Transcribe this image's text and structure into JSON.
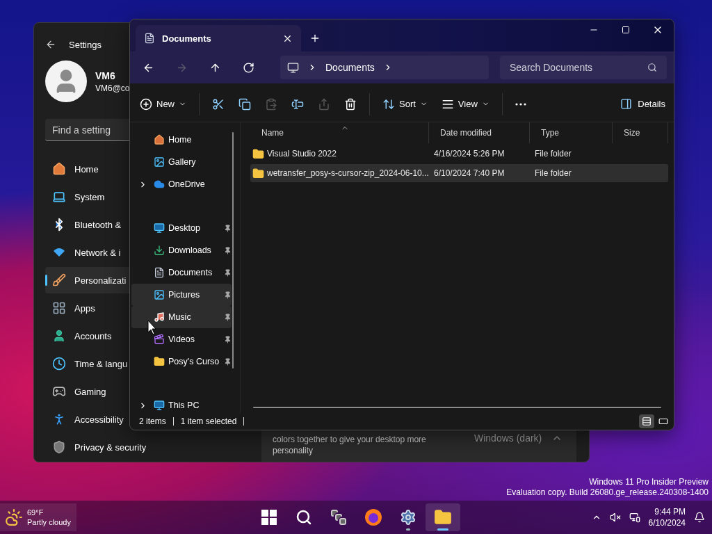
{
  "desktop": {
    "watermark": [
      "Windows 11 Pro Insider Preview",
      "Evaluation copy. Build 26080.ge_release.240308-1400"
    ]
  },
  "settings_window": {
    "title": "Settings",
    "user": {
      "name": "VM6",
      "email": "VM6@co"
    },
    "search": {
      "placeholder": "Find a setting"
    },
    "nav": [
      {
        "kind": "home",
        "label": "Home",
        "selected": false
      },
      {
        "kind": "system",
        "label": "System",
        "selected": false
      },
      {
        "kind": "bluetooth",
        "label": "Bluetooth &",
        "selected": false
      },
      {
        "kind": "network",
        "label": "Network & i",
        "selected": false
      },
      {
        "kind": "personalization",
        "label": "Personalizati",
        "selected": true
      },
      {
        "kind": "apps",
        "label": "Apps",
        "selected": false
      },
      {
        "kind": "accounts",
        "label": "Accounts",
        "selected": false
      },
      {
        "kind": "time",
        "label": "Time & langu",
        "selected": false
      },
      {
        "kind": "gaming",
        "label": "Gaming",
        "selected": false
      },
      {
        "kind": "accessibility",
        "label": "Accessibility",
        "selected": false
      },
      {
        "kind": "privacy",
        "label": "Privacy & security",
        "selected": false
      }
    ],
    "card": {
      "description": "colors together to give your desktop more personality",
      "value": "Windows (dark)",
      "expanded": true
    }
  },
  "explorer": {
    "tab": {
      "title": "Documents"
    },
    "nav_buttons": [
      {
        "kind": "back",
        "disabled": false
      },
      {
        "kind": "forward",
        "disabled": true
      },
      {
        "kind": "up",
        "disabled": false
      },
      {
        "kind": "refresh",
        "disabled": false
      }
    ],
    "breadcrumb": [
      "Documents"
    ],
    "search": {
      "placeholder": "Search Documents"
    },
    "toolbar": [
      [
        {
          "kind": "new",
          "label": "New",
          "dropdown": true,
          "disabled": false
        }
      ],
      [
        {
          "kind": "cut",
          "disabled": false
        },
        {
          "kind": "copy",
          "disabled": false
        },
        {
          "kind": "paste",
          "disabled": true
        },
        {
          "kind": "rename",
          "disabled": false
        },
        {
          "kind": "share",
          "disabled": true
        },
        {
          "kind": "delete",
          "disabled": false
        }
      ],
      [
        {
          "kind": "sort",
          "label": "Sort",
          "dropdown": true,
          "disabled": false
        },
        {
          "kind": "view",
          "label": "View",
          "dropdown": true,
          "disabled": false
        }
      ],
      [
        {
          "kind": "more",
          "disabled": false
        }
      ]
    ],
    "details_button": "Details",
    "sidebar": [
      [
        {
          "kind": "home",
          "label": "Home",
          "expandable": false,
          "pinned": false,
          "highlighted": false
        },
        {
          "kind": "gallery",
          "label": "Gallery",
          "expandable": false,
          "pinned": false,
          "highlighted": false
        },
        {
          "kind": "onedrive",
          "label": "OneDrive",
          "expandable": true,
          "pinned": false,
          "highlighted": false
        }
      ],
      [
        {
          "kind": "desktop",
          "label": "Desktop",
          "expandable": false,
          "pinned": true,
          "highlighted": false
        },
        {
          "kind": "downloads",
          "label": "Downloads",
          "expandable": false,
          "pinned": true,
          "highlighted": false
        },
        {
          "kind": "documents",
          "label": "Documents",
          "expandable": false,
          "pinned": true,
          "highlighted": false
        },
        {
          "kind": "pictures",
          "label": "Pictures",
          "expandable": false,
          "pinned": true,
          "highlighted": true
        },
        {
          "kind": "music",
          "label": "Music",
          "expandable": false,
          "pinned": true,
          "highlighted": true
        },
        {
          "kind": "videos",
          "label": "Videos",
          "expandable": false,
          "pinned": true,
          "highlighted": false
        },
        {
          "kind": "folder",
          "label": "Posy's Curso",
          "expandable": false,
          "pinned": true,
          "highlighted": false
        }
      ],
      [
        {
          "kind": "thispc",
          "label": "This PC",
          "expandable": true,
          "pinned": false,
          "highlighted": false
        }
      ]
    ],
    "columns": [
      "Name",
      "Date modified",
      "Type",
      "Size"
    ],
    "rows": [
      {
        "name": "Visual Studio 2022",
        "date": "4/16/2024 5:26 PM",
        "type": "File folder",
        "selected": false
      },
      {
        "name": "wetransfer_posy-s-cursor-zip_2024-06-10...",
        "date": "6/10/2024 7:40 PM",
        "type": "File folder",
        "selected": true
      }
    ],
    "status": [
      "2 items",
      "1 item selected"
    ],
    "views": [
      {
        "kind": "details",
        "selected": true
      },
      {
        "kind": "tiles",
        "selected": false
      }
    ]
  },
  "taskbar": {
    "weather": {
      "temp": "69°F",
      "condition": "Partly cloudy"
    },
    "apps": [
      {
        "kind": "start",
        "running": false,
        "active": false
      },
      {
        "kind": "search",
        "running": false,
        "active": false
      },
      {
        "kind": "taskview",
        "running": false,
        "active": false
      },
      {
        "kind": "firefox",
        "running": false,
        "active": false
      },
      {
        "kind": "settings",
        "running": true,
        "active": false
      },
      {
        "kind": "explorer",
        "running": true,
        "active": true
      }
    ],
    "clock": {
      "time": "9:44 PM",
      "date": "6/10/2024"
    }
  }
}
